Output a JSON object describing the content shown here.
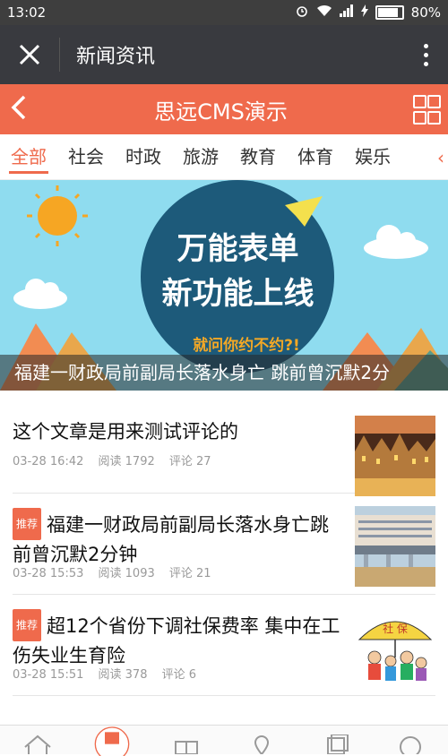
{
  "status": {
    "time": "13:02",
    "battery": "80%",
    "battery_level": 0.8
  },
  "appbar": {
    "title": "新闻资讯"
  },
  "channel": {
    "title": "思远CMS演示"
  },
  "tabs": [
    "全部",
    "社会",
    "时政",
    "旅游",
    "教育",
    "体育",
    "娱乐"
  ],
  "banner": {
    "headline_line1": "万能表单",
    "headline_line2": "新功能上线",
    "subline": "就问你约不约?!",
    "caption": "福建一财政局前副局长落水身亡 跳前曾沉默2分"
  },
  "articles": [
    {
      "title": "这个文章是用来测试评论的",
      "badge": "",
      "date": "03-28 16:42",
      "reads": "阅读 1792",
      "comments": "评论 27"
    },
    {
      "title": "福建一财政局前副局长落水身亡跳前曾沉默2分钟",
      "badge": "推荐",
      "date": "03-28 15:53",
      "reads": "阅读 1093",
      "comments": "评论 21"
    },
    {
      "title": "超12个省份下调社保费率 集中在工伤失业生育险",
      "badge": "推荐",
      "date": "03-28 15:51",
      "reads": "阅读 378",
      "comments": "评论 6"
    }
  ],
  "thumb3_text": "社 保",
  "colors": {
    "accent": "#ef6a4c",
    "appbar": "#393a3f",
    "statusbar": "#3e3e3e"
  }
}
